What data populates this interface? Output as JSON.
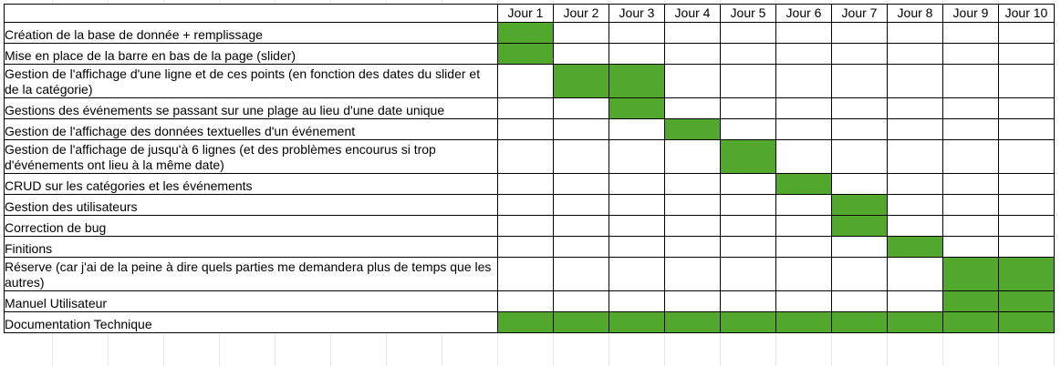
{
  "days": [
    "Jour 1",
    "Jour 2",
    "Jour 3",
    "Jour 4",
    "Jour 5",
    "Jour 6",
    "Jour 7",
    "Jour 8",
    "Jour 9",
    "Jour 10"
  ],
  "bar_color": "#52a82c",
  "tasks": [
    {
      "label": "Création de la base de donnée + remplissage",
      "active": [
        1
      ]
    },
    {
      "label": "Mise en place de la barre en bas de la page (slider)",
      "active": [
        1
      ]
    },
    {
      "label": "Gestion de l'affichage d'une ligne et de ces points (en fonction des dates du slider et de la catégorie)",
      "active": [
        2,
        3
      ]
    },
    {
      "label": "Gestions des événements se passant sur une plage au lieu d'une date unique",
      "active": [
        3
      ]
    },
    {
      "label": "Gestion de l'affichage des données textuelles d'un événement",
      "active": [
        4
      ]
    },
    {
      "label": "Gestion de l'affichage de jusqu'à 6 lignes (et des problèmes encourus si trop d'événements ont lieu à la même date)",
      "active": [
        5
      ]
    },
    {
      "label": "CRUD sur les catégories et les événements",
      "active": [
        6
      ]
    },
    {
      "label": "Gestion des utilisateurs",
      "active": [
        7
      ]
    },
    {
      "label": "Correction de bug",
      "active": [
        7
      ]
    },
    {
      "label": "Finitions",
      "active": [
        8
      ]
    },
    {
      "label": "Réserve (car j'ai de la peine à dire quels parties me demandera plus de temps que les autres)",
      "active": [
        9,
        10
      ]
    },
    {
      "label": "Manuel Utilisateur",
      "active": [
        9,
        10
      ]
    },
    {
      "label": "Documentation Technique",
      "active": [
        1,
        2,
        3,
        4,
        5,
        6,
        7,
        8,
        9,
        10
      ]
    }
  ]
}
